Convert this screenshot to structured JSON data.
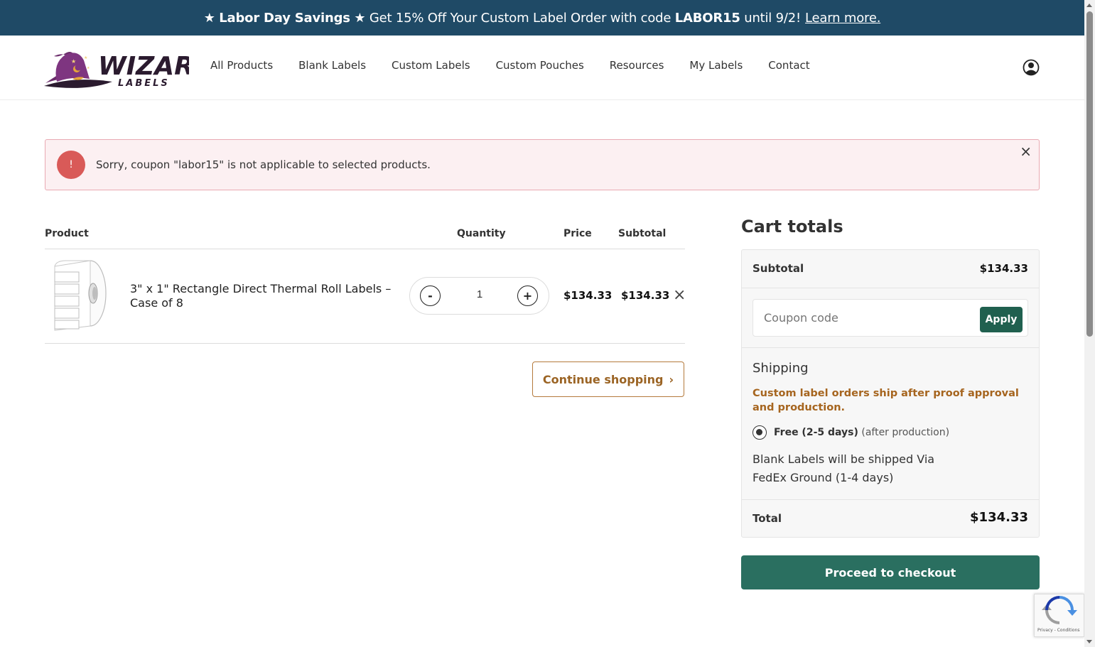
{
  "promo": {
    "star1": "★",
    "bold_title": "Labor Day Savings",
    "star2": "★",
    "text_before_code": "Get 15% Off Your Custom Label Order with code",
    "code": "LABOR15",
    "text_after_code": "until 9/2!",
    "link": "Learn more."
  },
  "header": {
    "logo_text": "WIZARD",
    "logo_subtext": "LABELS",
    "nav": [
      "All Products",
      "Blank Labels",
      "Custom Labels",
      "Custom Pouches",
      "Resources",
      "My Labels",
      "Contact"
    ]
  },
  "notice": {
    "icon": "!",
    "message": "Sorry, coupon \"labor15\" is not applicable to selected products.",
    "close": "×"
  },
  "cart": {
    "headers": {
      "product": "Product",
      "quantity": "Quantity",
      "price": "Price",
      "subtotal": "Subtotal"
    },
    "item": {
      "name": "3\" x 1\" Rectangle Direct Thermal Roll Labels – Case of 8",
      "qty_minus": "-",
      "qty_plus": "+",
      "quantity": "1",
      "price": "$134.33",
      "subtotal": "$134.33",
      "remove": "×"
    },
    "continue_label": "Continue shopping",
    "continue_chevron": "›"
  },
  "totals": {
    "title": "Cart totals",
    "subtotal_label": "Subtotal",
    "subtotal_value": "$134.33",
    "coupon_placeholder": "Coupon code",
    "apply_label": "Apply",
    "shipping_title": "Shipping",
    "shipping_note": "Custom label orders ship after proof approval and production.",
    "shipping_option_bold": "Free (2-5 days)",
    "shipping_option_rest": "(after production)",
    "blank_shipping": "Blank Labels will be shipped Via FedEx Ground (1-4 days)",
    "total_label": "Total",
    "total_value": "$134.33",
    "checkout_label": "Proceed to checkout"
  },
  "recaptcha": {
    "small_text": "Privacy - Conditions"
  },
  "colors": {
    "promo_bg": "#1f4a66",
    "notice_bg": "#fcf0f2",
    "notice_icon": "#d95a58",
    "accent_brown": "#9b6424",
    "checkout_green": "#2a6f60"
  }
}
